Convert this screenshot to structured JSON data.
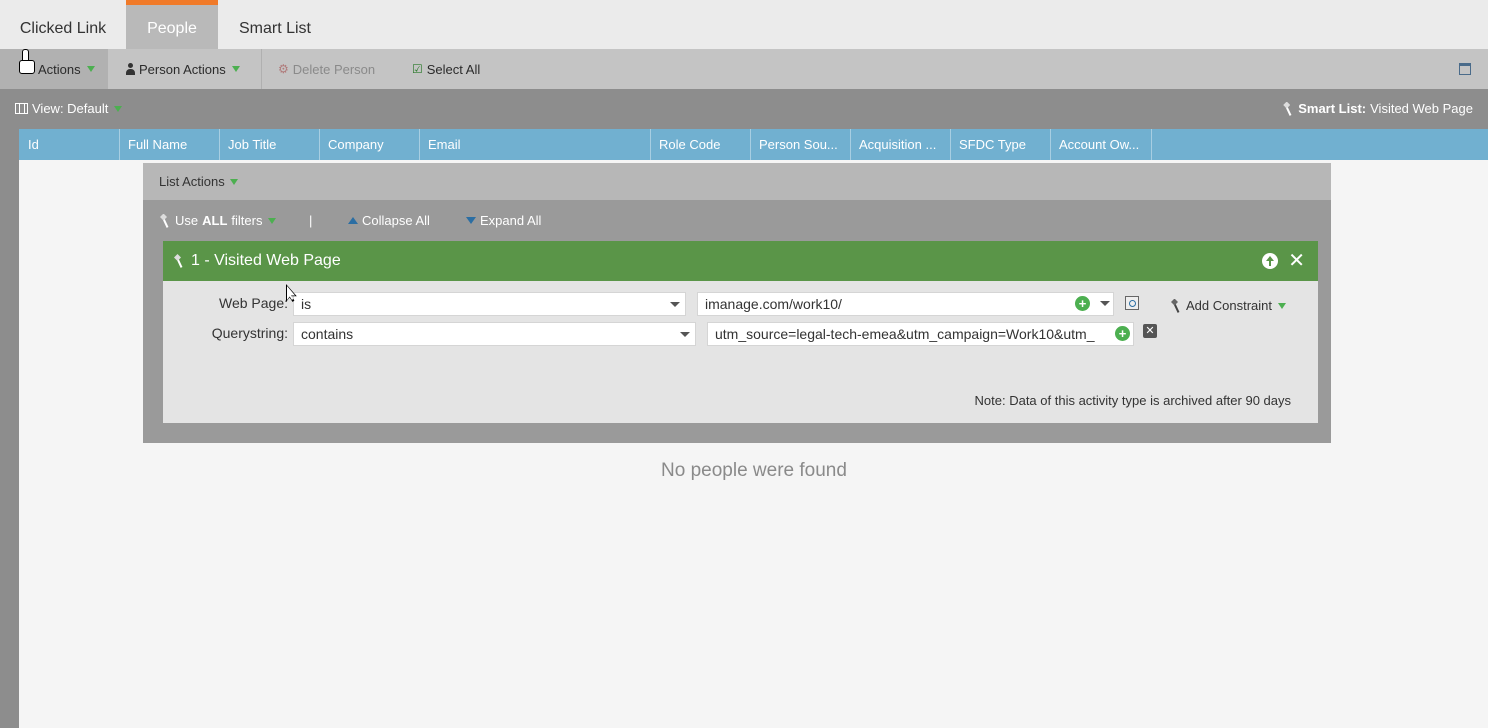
{
  "tabs": [
    {
      "label": "Clicked Link",
      "active": false
    },
    {
      "label": "People",
      "active": true
    },
    {
      "label": "Smart List",
      "active": false
    }
  ],
  "toolbar": {
    "actions_label": "Actions",
    "person_actions_label": "Person Actions",
    "delete_person_label": "Delete Person",
    "select_all_label": "Select All"
  },
  "viewbar": {
    "view_label": "View: Default",
    "smartlist_prefix": "Smart List:",
    "smartlist_name": "Visited Web Page"
  },
  "grid": {
    "columns": [
      "Id",
      "Full Name",
      "Job Title",
      "Company",
      "Email",
      "Role Code",
      "Person Sou...",
      "Acquisition ...",
      "SFDC Type",
      "Account Ow..."
    ]
  },
  "smartlist": {
    "list_actions_label": "List Actions",
    "filters_prefix": "Use",
    "filters_bold": "ALL",
    "filters_suffix": "filters",
    "pipe": "|",
    "collapse_label": "Collapse All",
    "expand_label": "Expand All",
    "filter": {
      "title": "1 - Visited Web Page",
      "add_constraint_label": "Add Constraint",
      "rows": [
        {
          "label": "Web Page:",
          "operator": "is",
          "value": "imanage.com/work10/"
        },
        {
          "label": "Querystring:",
          "operator": "contains",
          "value": "utm_source=legal-tech-emea&utm_campaign=Work10&utm_"
        }
      ],
      "note": "Note: Data of this activity type is archived after 90 days"
    }
  },
  "empty_message": "No people were found",
  "colors": {
    "accent_orange": "#f07a29",
    "grid_header_blue": "#71b0d0",
    "filter_green": "#5a9548"
  }
}
